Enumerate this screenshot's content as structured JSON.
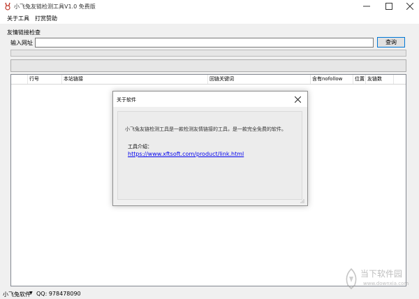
{
  "window": {
    "title": "小飞兔友链检测工具V1.0 免费版",
    "icon": "rabbit-icon"
  },
  "menu": {
    "items": [
      {
        "label": "关于工具"
      },
      {
        "label": "打赏赞助"
      }
    ]
  },
  "main": {
    "group_label": "友情链接检查",
    "url_label": "输入网址",
    "url_value": "",
    "query_button": "查询",
    "table": {
      "columns": [
        "行号",
        "本站链接",
        "回链关键词",
        "含有nofollow",
        "位置",
        "友链数"
      ]
    }
  },
  "statusbar": {
    "brand": "小飞兔软件",
    "qq": "QQ: 978478090"
  },
  "dialog": {
    "title": "关于软件",
    "description": "小飞兔友链检测工具是一款检测友情链接的工具，是一款完全免费的软件。",
    "intro_label": "工具介绍：",
    "link": "https://www.xftsoft.com/product/link.html"
  },
  "watermark": {
    "text": "当下软件园",
    "sub": "www.downxia.com"
  },
  "colors": {
    "accent": "#0078d7",
    "link": "#0000ee",
    "window_bg": "#f0f0f0"
  }
}
